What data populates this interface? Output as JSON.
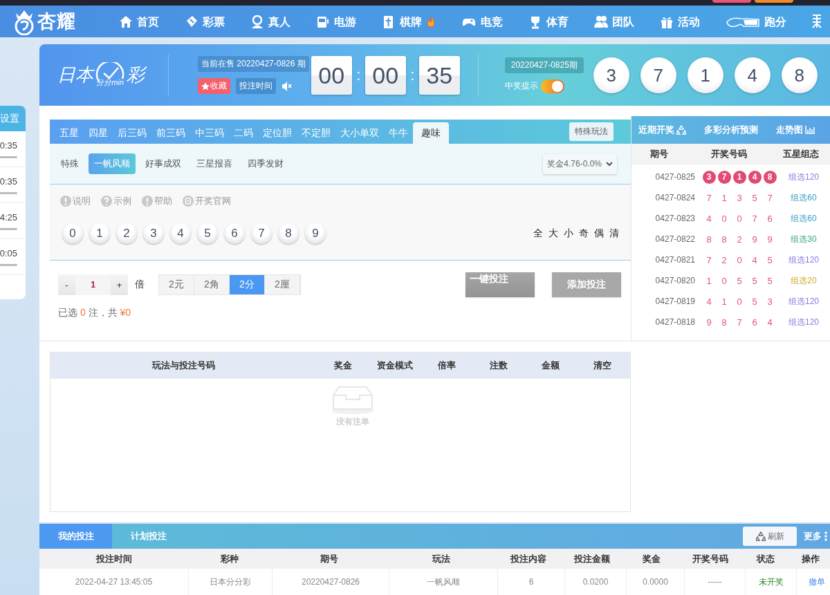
{
  "nav": {
    "logo": "杏耀",
    "items": [
      {
        "label": "首页",
        "hot": false
      },
      {
        "label": "彩票",
        "hot": false
      },
      {
        "label": "真人",
        "hot": false
      },
      {
        "label": "电游",
        "hot": false
      },
      {
        "label": "棋牌",
        "hot": true
      },
      {
        "label": "电竞",
        "hot": false
      },
      {
        "label": "体育",
        "hot": false
      },
      {
        "label": "团队",
        "hot": false
      },
      {
        "label": "活动",
        "hot": false
      },
      {
        "label": "跑分",
        "hot": false
      }
    ]
  },
  "sidebar": {
    "title": "设置",
    "timers": [
      {
        "time": "0:35",
        "level": 1
      },
      {
        "time": "0:35",
        "level": 1
      },
      {
        "time": "4:25",
        "level": 1
      },
      {
        "time": "0:05",
        "level": 1
      }
    ]
  },
  "lottery": {
    "name_left": "日本",
    "name_sub": "分分min",
    "name_right": "彩",
    "current": "当前在售 20220427-0826 期",
    "favorite": "收藏",
    "bet_time": "投注时间",
    "muted": true,
    "countdown": {
      "segments": [
        "00",
        "00",
        "35"
      ],
      "separators": [
        ":",
        ":"
      ]
    },
    "last_issue": "20220427-0825期",
    "alert_label": "中奖提示",
    "alert_on": true,
    "balls": [
      "3",
      "7",
      "1",
      "4",
      "8"
    ]
  },
  "game": {
    "tabs": [
      {
        "label": "五星",
        "selected": false
      },
      {
        "label": "四星",
        "selected": false
      },
      {
        "label": "后三码",
        "selected": false
      },
      {
        "label": "前三码",
        "selected": false
      },
      {
        "label": "中三码",
        "selected": false
      },
      {
        "label": "二码",
        "selected": false
      },
      {
        "label": "定位胆",
        "selected": false
      },
      {
        "label": "不定胆",
        "selected": false
      },
      {
        "label": "大小单双",
        "selected": false
      },
      {
        "label": "牛牛",
        "selected": false
      },
      {
        "label": "趣味",
        "selected": true
      }
    ],
    "special_button": "特殊玩法",
    "subtabs": [
      {
        "label": "特殊",
        "selected": false
      },
      {
        "label": "一帆风顺",
        "selected": true
      },
      {
        "label": "好事成双",
        "selected": false
      },
      {
        "label": "三星报喜",
        "selected": false
      },
      {
        "label": "四季发财",
        "selected": false
      }
    ],
    "odds": "奖金4.76-0.0%",
    "links": [
      "说明",
      "示例",
      "帮助",
      "开奖官网"
    ],
    "digits": [
      {
        "label": "0",
        "selected": false
      },
      {
        "label": "1",
        "selected": false
      },
      {
        "label": "2",
        "selected": false
      },
      {
        "label": "3",
        "selected": false
      },
      {
        "label": "4",
        "selected": false
      },
      {
        "label": "5",
        "selected": false
      },
      {
        "label": "6",
        "selected": false
      },
      {
        "label": "7",
        "selected": false
      },
      {
        "label": "8",
        "selected": false
      },
      {
        "label": "9",
        "selected": false
      }
    ],
    "quick": [
      "全",
      "大",
      "小",
      "奇",
      "偶",
      "清"
    ],
    "multiplier": {
      "minus": "-",
      "value": "1",
      "plus": "+",
      "unit": "倍"
    },
    "units": [
      {
        "label": "2元",
        "selected": false
      },
      {
        "label": "2角",
        "selected": false
      },
      {
        "label": "2分",
        "selected": true
      },
      {
        "label": "2厘",
        "selected": false
      }
    ],
    "actions": [
      {
        "label": "一键投注",
        "disabled": true,
        "kind": "quick"
      },
      {
        "label": "添加投注",
        "disabled": true,
        "kind": "add"
      }
    ],
    "summary": {
      "prefix": "已选",
      "count": "0",
      "middle": "注，共",
      "total": "¥0"
    }
  },
  "results": {
    "tabs": [
      "近期开奖",
      "多彩分析预测",
      "走势图"
    ],
    "columns": [
      "期号",
      "开奖号码",
      "五星组态"
    ],
    "rows": [
      {
        "issue": "0427-0825",
        "numbers": [
          "3",
          "7",
          "1",
          "4",
          "8"
        ],
        "highlighted": true,
        "pattern": "组选120",
        "color": "#8a7be0"
      },
      {
        "issue": "0427-0824",
        "numbers": [
          "7",
          "1",
          "3",
          "5",
          "7"
        ],
        "highlighted": false,
        "pattern": "组选60",
        "color": "#3a9fbf"
      },
      {
        "issue": "0427-0823",
        "numbers": [
          "4",
          "0",
          "0",
          "7",
          "6"
        ],
        "highlighted": false,
        "pattern": "组选60",
        "color": "#3a9fbf"
      },
      {
        "issue": "0427-0822",
        "numbers": [
          "8",
          "8",
          "2",
          "9",
          "9"
        ],
        "highlighted": false,
        "pattern": "组选30",
        "color": "#3aa57a"
      },
      {
        "issue": "0427-0821",
        "numbers": [
          "7",
          "2",
          "0",
          "4",
          "5"
        ],
        "highlighted": false,
        "pattern": "组选120",
        "color": "#8a7be0"
      },
      {
        "issue": "0427-0820",
        "numbers": [
          "1",
          "0",
          "5",
          "5",
          "5"
        ],
        "highlighted": false,
        "pattern": "组选20",
        "color": "#d4a62a"
      },
      {
        "issue": "0427-0819",
        "numbers": [
          "4",
          "1",
          "0",
          "5",
          "3"
        ],
        "highlighted": false,
        "pattern": "组选120",
        "color": "#8a7be0"
      },
      {
        "issue": "0427-0818",
        "numbers": [
          "9",
          "8",
          "7",
          "6",
          "4"
        ],
        "highlighted": false,
        "pattern": "组选120",
        "color": "#8a7be0"
      }
    ]
  },
  "bet_list": {
    "columns": [
      "玩法与投注号码",
      "奖金",
      "资金模式",
      "倍率",
      "注数",
      "金额",
      "清空"
    ],
    "empty": "没有注单"
  },
  "history": {
    "tabs": [
      {
        "label": "我的投注",
        "selected": true
      },
      {
        "label": "计划投注",
        "selected": false
      }
    ],
    "refresh": "刷新",
    "more": "更多",
    "columns": [
      "投注时间",
      "彩种",
      "期号",
      "玩法",
      "投注内容",
      "投注金额",
      "奖金",
      "开奖号码",
      "状态",
      "操作"
    ],
    "rows": [
      {
        "time": "2022-04-27 13:45:05",
        "lottery": "日本分分彩",
        "issue": "20220427-0826",
        "play": "一帆风顺",
        "content": "6",
        "amount": "0.0200",
        "prize": "0.0000",
        "numbers": "-----",
        "status": "未开奖",
        "action": "撤单"
      }
    ]
  }
}
